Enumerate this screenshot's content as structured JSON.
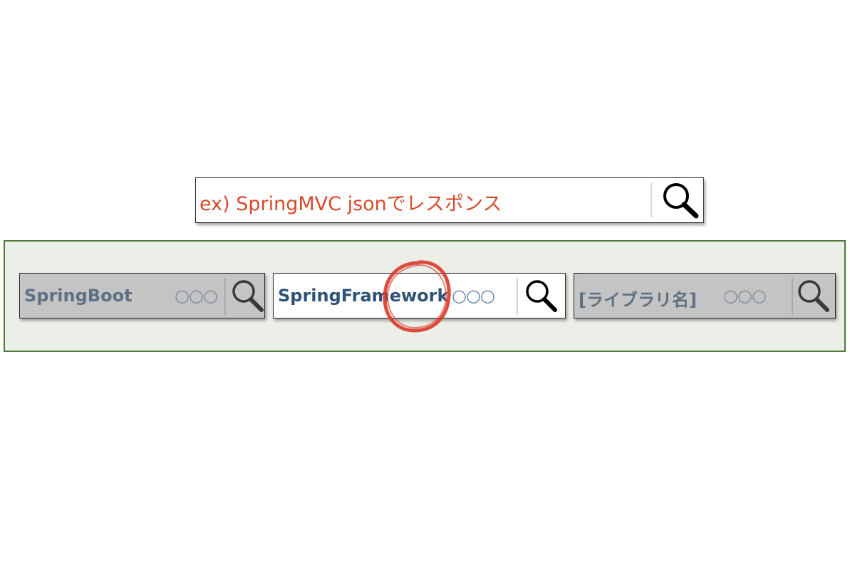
{
  "main_search": {
    "query": "ex) SpringMVC jsonでレスポンス",
    "search_icon": "search-icon",
    "query_color": "#d44a2c"
  },
  "library_searches": [
    {
      "term": "SpringBoot",
      "placeholder": "○○○",
      "state": "inactive",
      "search_icon": "search-icon"
    },
    {
      "term": "SpringFramework",
      "placeholder": "○○○",
      "state": "active",
      "search_icon": "search-icon"
    },
    {
      "term": "[ライブラリ名]",
      "placeholder": "○○○",
      "state": "inactive",
      "search_icon": "search-icon"
    }
  ],
  "colors": {
    "group_background": "#ebefe8",
    "group_border": "#4c7a37",
    "inactive_box": "#c4c4c4",
    "highlight_circle": "#d83a2a"
  }
}
